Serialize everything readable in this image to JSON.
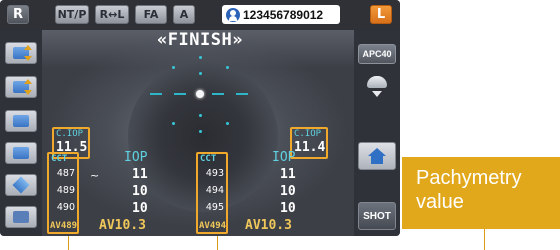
{
  "topbar": {
    "right_eye_label": "R",
    "buttons": [
      "NT/P",
      "R↔L",
      "FA",
      "A"
    ],
    "patient_id": "123456789012",
    "left_eye_label": "L"
  },
  "screen_title": "«FINISH»",
  "right_panel": {
    "apc_label": "APC40",
    "shot_label": "SHOT"
  },
  "right_eye": {
    "ciop_label": "C.IOP",
    "ciop_value": "11.5",
    "cct_header": "CCT",
    "cct_values": [
      "487",
      "489",
      "490"
    ],
    "cct_avg": "AV489",
    "iop_header": "IOP",
    "iop_values": [
      "11",
      "10",
      "10"
    ],
    "iop_avg": "AV10.3",
    "tilde": "~"
  },
  "left_eye": {
    "ciop_label": "C.IOP",
    "ciop_value": "11.4",
    "cct_header": "CCT",
    "cct_values": [
      "493",
      "494",
      "495"
    ],
    "cct_avg": "AV494",
    "iop_header": "IOP",
    "iop_values": [
      "11",
      "10",
      "10"
    ],
    "iop_avg": "AV10.3"
  },
  "annotation": {
    "callout_line1": "Pachymetry",
    "callout_line2": "value"
  },
  "colors": {
    "highlight_border": "#f0a92a",
    "callout_bg": "#e2a81c",
    "label_cyan": "#5fd1e1",
    "avg_yellow": "#f0c75a"
  }
}
